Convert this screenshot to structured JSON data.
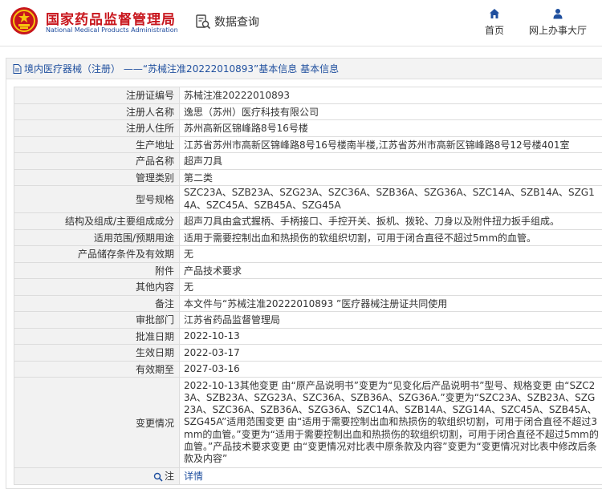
{
  "header": {
    "logo_cn": "国家药品监督管理局",
    "logo_en": "National Medical Products Administration",
    "search_label": "数据查询",
    "nav_home": "首页",
    "nav_service": "网上办事大厅"
  },
  "breadcrumb": {
    "category": "境内医疗器械（注册）",
    "sep": "——",
    "title": "“苏械注准20222010893”基本信息"
  },
  "colors": {
    "accent": "#1f4f9e",
    "brand_red": "#c8161d"
  },
  "rows": [
    {
      "label": "注册证编号",
      "value": "苏械注准20222010893"
    },
    {
      "label": "注册人名称",
      "value": "逸思（苏州）医疗科技有限公司"
    },
    {
      "label": "注册人住所",
      "value": "苏州高新区锦峰路8号16号楼"
    },
    {
      "label": "生产地址",
      "value": "江苏省苏州市高新区锦峰路8号16号楼南半楼,江苏省苏州市高新区锦峰路8号12号楼401室"
    },
    {
      "label": "产品名称",
      "value": "超声刀具"
    },
    {
      "label": "管理类别",
      "value": "第二类"
    },
    {
      "label": "型号规格",
      "value": "SZC23A、SZB23A、SZG23A、SZC36A、SZB36A、SZG36A、SZC14A、SZB14A、SZG14A、SZC45A、SZB45A、SZG45A"
    },
    {
      "label": "结构及组成/主要组成成分",
      "value": "超声刀具由盒式握柄、手柄接口、手控开关、扳机、拨轮、刀身以及附件扭力扳手组成。"
    },
    {
      "label": "适用范围/预期用途",
      "value": "适用于需要控制出血和热损伤的软组织切割，可用于闭合直径不超过5mm的血管。"
    },
    {
      "label": "产品储存条件及有效期",
      "value": "无"
    },
    {
      "label": "附件",
      "value": "产品技术要求"
    },
    {
      "label": "其他内容",
      "value": "无"
    },
    {
      "label": "备注",
      "value": "本文件与“苏械注准20222010893 ”医疗器械注册证共同使用"
    },
    {
      "label": "审批部门",
      "value": "江苏省药品监督管理局"
    },
    {
      "label": "批准日期",
      "value": "2022-10-13"
    },
    {
      "label": "生效日期",
      "value": "2022-03-17"
    },
    {
      "label": "有效期至",
      "value": "2027-03-16"
    },
    {
      "label": "变更情况",
      "value": "2022-10-13其他变更 由“原产品说明书”变更为“见变化后产品说明书”型号、规格变更 由“SZC23A、SZB23A、SZG23A、SZC36A、SZB36A、SZG36A.”变更为“SZC23A、SZB23A、SZG23A、SZC36A、SZB36A、SZG36A、SZC14A、SZB14A、SZG14A、SZC45A、SZB45A、SZG45A”适用范围变更 由“适用于需要控制出血和热损伤的软组织切割，可用于闭合直径不超过3mm的血管。”变更为“适用于需要控制出血和热损伤的软组织切割，可用于闭合直径不超过5mm的血管。”产品技术要求变更 由“变更情况对比表中原条款及内容”变更为“变更情况对比表中修改后条款及内容”"
    },
    {
      "label": "注",
      "value": "详情"
    }
  ]
}
